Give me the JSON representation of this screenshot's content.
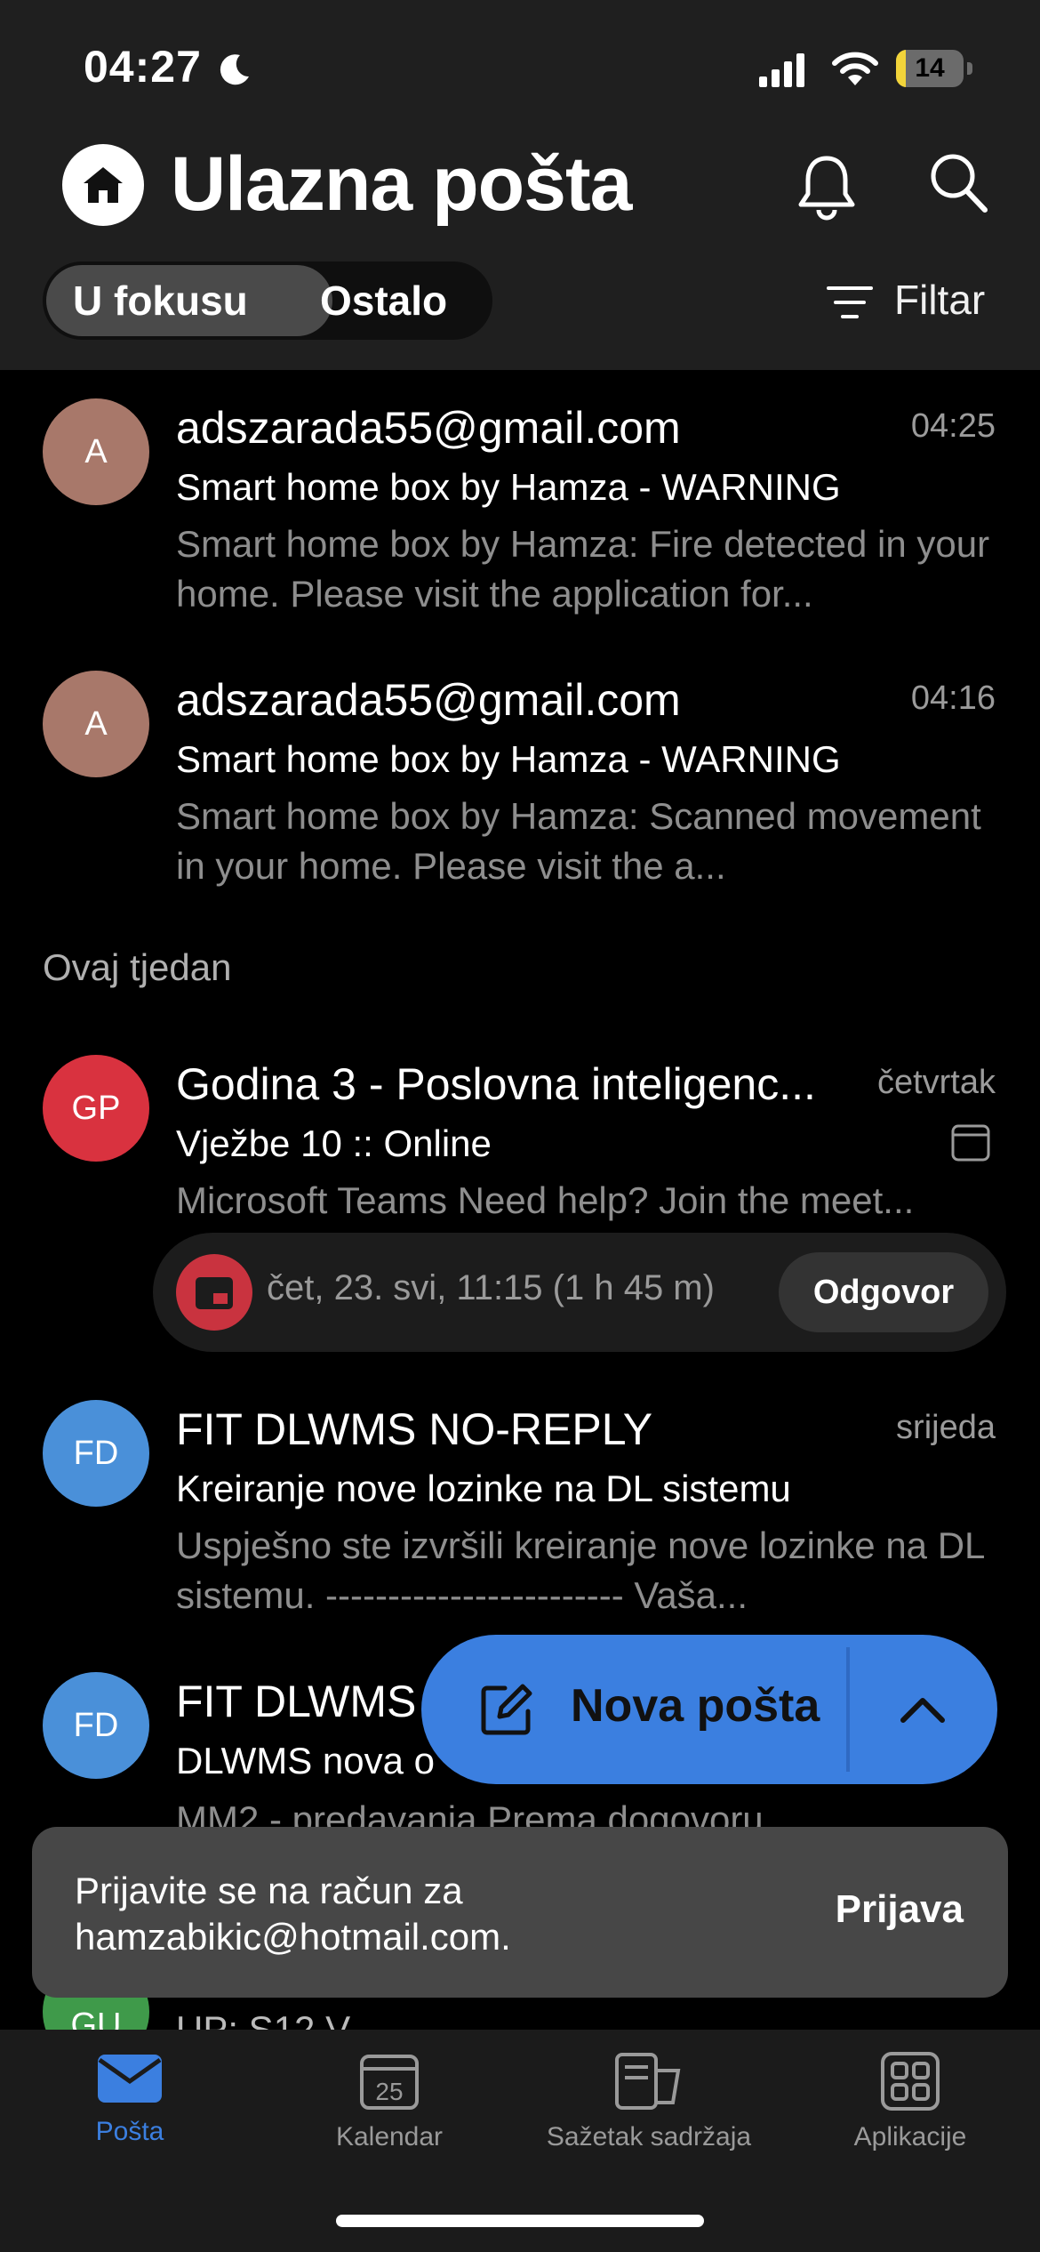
{
  "status_bar": {
    "time": "04:27",
    "battery": "14",
    "battery_level": 0.14
  },
  "header": {
    "title": "Ulazna pošta",
    "tabs": [
      {
        "label": "U fokusu",
        "selected": true
      },
      {
        "label": "Ostalo",
        "selected": false
      }
    ],
    "filter_label": "Filtar"
  },
  "messages": [
    {
      "initials": "A",
      "avatar_color": "#a8786a",
      "from": "adszarada55@gmail.com",
      "time": "04:25",
      "subject": "Smart home box by Hamza - WARNING",
      "preview": "Smart home box by Hamza: Fire detected in your home. Please visit the application for..."
    },
    {
      "initials": "A",
      "avatar_color": "#a8786a",
      "from": "adszarada55@gmail.com",
      "time": "04:16",
      "subject": "Smart home box by Hamza - WARNING",
      "preview": "Smart home box by Hamza: Scanned movement in your home. Please visit the a..."
    }
  ],
  "section_label": "Ovaj tjedan",
  "week_messages": [
    {
      "initials": "GP",
      "avatar_color": "#d9323f",
      "from": "Godina 3 - Poslovna inteligenc...",
      "time": "četvrtak",
      "subject": "Vježbe 10 :: Online",
      "preview": "Microsoft Teams Need help? Join the meet...",
      "event": {
        "when": "čet, 23. svi, 11:15 (1 h 45 m)",
        "action": "Odgovor"
      }
    },
    {
      "initials": "FD",
      "avatar_color": "#4a90d9",
      "from": "FIT DLWMS NO-REPLY",
      "time": "srijeda",
      "subject": "Kreiranje nove lozinke na DL sistemu",
      "preview": "Uspješno ste izvršili kreiranje nove lozinke na DL sistemu. ------------------------ Vaša..."
    },
    {
      "initials": "FD",
      "avatar_color": "#4a90d9",
      "from": "FIT DLWMS",
      "time": "",
      "subject": "DLWMS nova o",
      "preview": "MM2 - predavanja Prema dogovoru"
    }
  ],
  "compose": {
    "label": "Nova pošta"
  },
  "toast": {
    "message": "Prijavite se na račun za hamzabikic@hotmail.com.",
    "action": "Prijava"
  },
  "peek": {
    "initials": "GU",
    "text": "UP: S12 V"
  },
  "tabbar": [
    {
      "label": "Pošta",
      "icon": "mail-icon",
      "active": true
    },
    {
      "label": "Kalendar",
      "icon": "calendar-icon",
      "active": false,
      "date": "25"
    },
    {
      "label": "Sažetak sadržaja",
      "icon": "feed-icon",
      "active": false
    },
    {
      "label": "Aplikacije",
      "icon": "apps-icon",
      "active": false
    }
  ],
  "colors": {
    "accent": "#3b7fe0",
    "header_bg": "#1f1f1f",
    "list_bg": "#000000",
    "toast_bg": "#474747"
  }
}
